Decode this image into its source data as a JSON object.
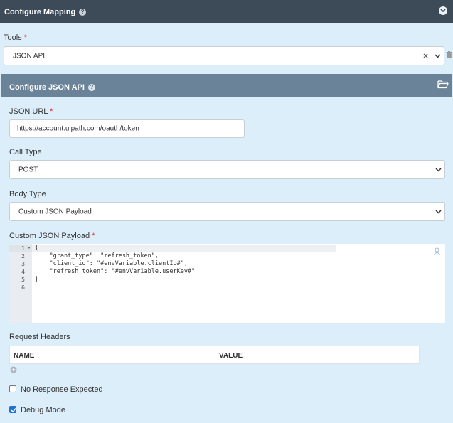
{
  "header": {
    "title": "Configure Mapping"
  },
  "tools": {
    "label": "Tools",
    "required_mark": "*",
    "selected": "JSON API"
  },
  "panel": {
    "title": "Configure JSON API",
    "json_url": {
      "label": "JSON URL",
      "required_mark": "*",
      "value": "https://account.uipath.com/oauth/token"
    },
    "call_type": {
      "label": "Call Type",
      "selected": "POST"
    },
    "body_type": {
      "label": "Body Type",
      "selected": "Custom JSON Payload"
    },
    "payload": {
      "label": "Custom JSON Payload",
      "required_mark": "*",
      "line_numbers": [
        "1",
        "2",
        "3",
        "4",
        "5",
        "6"
      ],
      "lines": [
        "{",
        "    \"grant_type\": \"refresh_token\",",
        "    \"client_id\": \"#envVariable.clientId#\",",
        "    \"refresh_token\": \"#envVariable.userKey#\"",
        "}",
        ""
      ]
    },
    "request_headers": {
      "label": "Request Headers",
      "columns": [
        "NAME",
        "VALUE"
      ]
    },
    "no_response": {
      "label": "No Response Expected",
      "checked": false
    },
    "debug_mode": {
      "label": "Debug Mode",
      "checked": true
    }
  },
  "colors": {
    "topbar": "#3d4a58",
    "panel_header": "#6b8399",
    "background": "#ddeefb",
    "checkbox_checked": "#1e74d6",
    "required": "#d32f2f"
  }
}
